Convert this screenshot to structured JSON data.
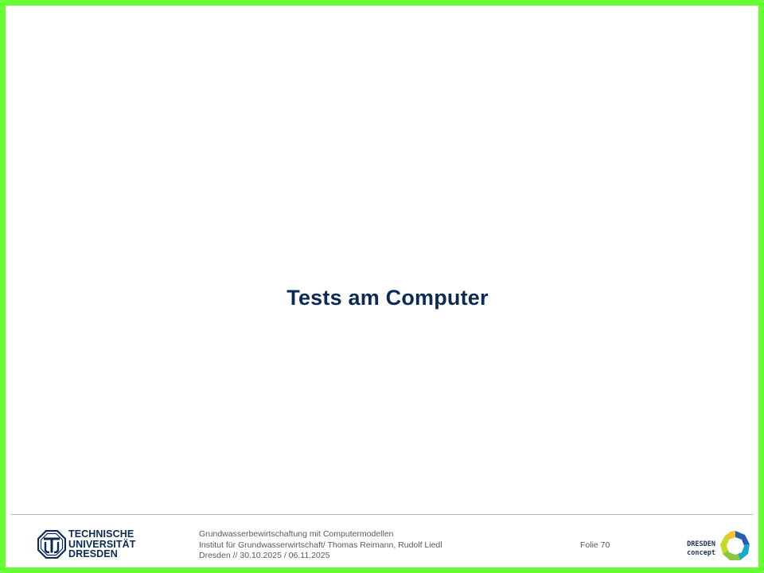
{
  "slide": {
    "title": "Tests am Computer"
  },
  "footer": {
    "university_logo": {
      "line1": "TECHNISCHE",
      "line2": "UNIVERSITÄT",
      "line3": "DRESDEN",
      "color": "#0b2a55"
    },
    "course": "Grundwasserbewirtschaftung mit Computermodellen",
    "institute": "Institut für Grundwasserwirtschaft/ Thomas Reimann, Rudolf Liedl",
    "place_date": "Dresden // 30.10.2025 / 06.11.2025",
    "slide_number": "Folie 70",
    "partner_logo": {
      "line1": "DRESDEN",
      "line2": "concept"
    }
  },
  "colors": {
    "border": "#66ff33",
    "title": "#0b2a55",
    "footer_text": "#5a5a5a"
  }
}
